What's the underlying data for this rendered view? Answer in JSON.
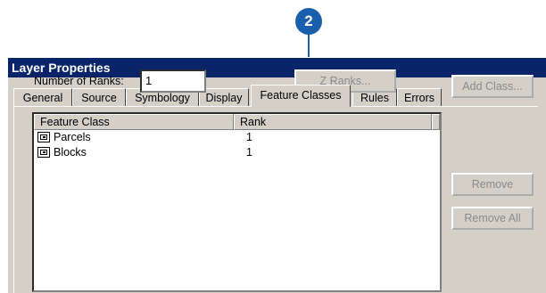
{
  "callout": {
    "number": "2"
  },
  "dialog": {
    "title": "Layer Properties",
    "tabs": [
      {
        "label": "General"
      },
      {
        "label": "Source"
      },
      {
        "label": "Symbology"
      },
      {
        "label": "Display"
      },
      {
        "label": "Feature Classes",
        "active": true
      },
      {
        "label": "Rules"
      },
      {
        "label": "Errors"
      }
    ],
    "ranks_label": "Number of Ranks:",
    "ranks_value": "1",
    "z_ranks_button": "Z Ranks...",
    "add_class_button": "Add Class...",
    "remove_button": "Remove",
    "remove_all_button": "Remove All",
    "table": {
      "columns": [
        "Feature Class",
        "Rank"
      ],
      "rows": [
        {
          "feature_class": "Parcels",
          "rank": "1"
        },
        {
          "feature_class": "Blocks",
          "rank": "1"
        }
      ]
    }
  }
}
